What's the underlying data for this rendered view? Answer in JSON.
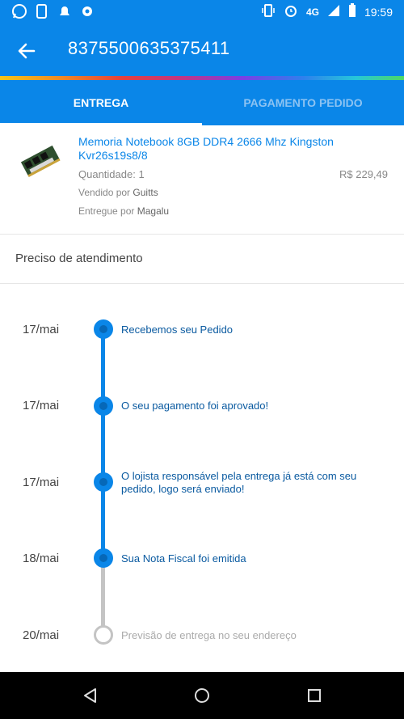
{
  "status_bar": {
    "time": "19:59",
    "network": "4G"
  },
  "app_bar": {
    "order_id": "8375500635375411"
  },
  "tabs": [
    {
      "label": "ENTREGA"
    },
    {
      "label": "PAGAMENTO PEDIDO"
    }
  ],
  "product": {
    "name": "Memoria Notebook 8GB DDR4 2666 Mhz Kingston Kvr26s19s8/8",
    "quantity": "Quantidade: 1",
    "price": "R$ 229,49",
    "sold_by_label": "Vendido por",
    "sold_by": "Guitts",
    "delivered_by_label": "Entregue por",
    "delivered_by": "Magalu"
  },
  "help": {
    "label": "Preciso de atendimento"
  },
  "timeline": [
    {
      "date": "17/mai",
      "text": "Recebemos seu Pedido"
    },
    {
      "date": "17/mai",
      "text": "O seu pagamento foi aprovado!"
    },
    {
      "date": "17/mai",
      "text": "O lojista responsável pela entrega já está com seu pedido, logo será enviado!"
    },
    {
      "date": "18/mai",
      "text": "Sua Nota Fiscal foi emitida"
    },
    {
      "date": "20/mai",
      "text": "Previsão de entrega no seu endereço"
    }
  ],
  "colors": {
    "primary": "#0a86e8",
    "timeline_pending": "#c4c4c4"
  },
  "icons": [
    "whatsapp-icon",
    "back-arrow-icon",
    "vibrate-icon",
    "alarm-icon",
    "signal-icon",
    "battery-icon",
    "nav-back-icon",
    "nav-home-icon",
    "nav-recents-icon"
  ]
}
